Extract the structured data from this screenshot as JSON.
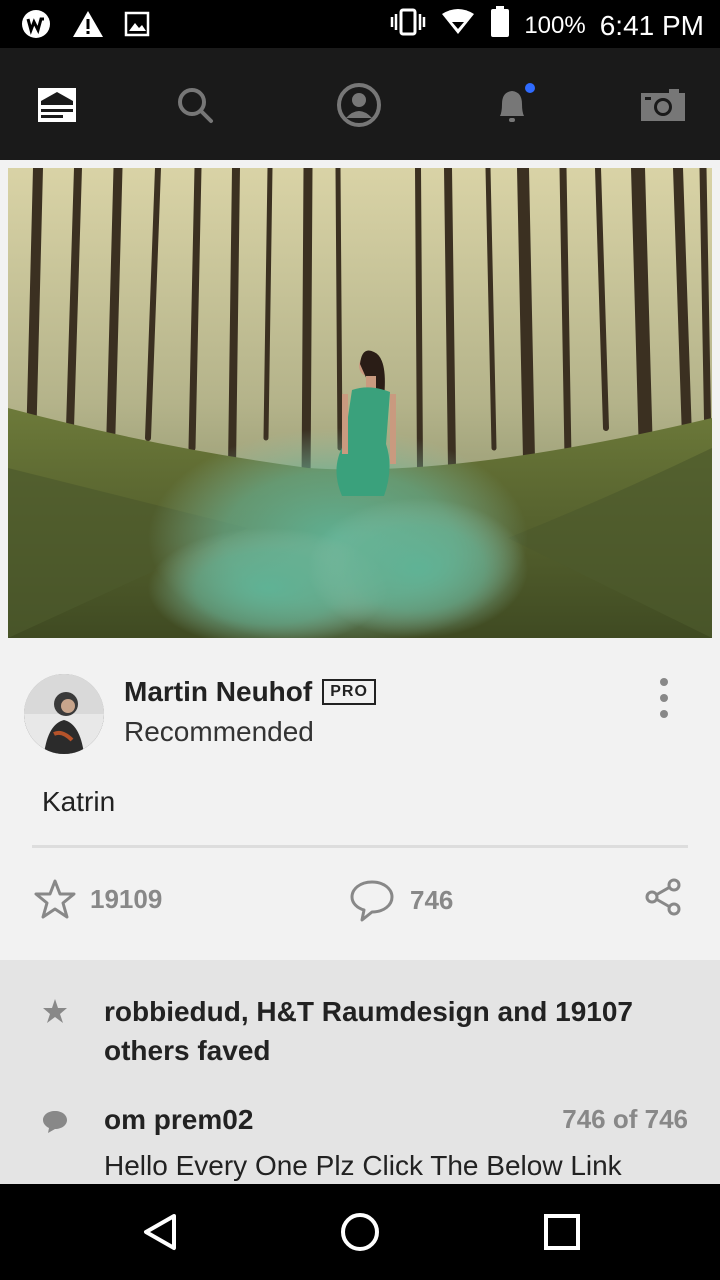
{
  "status_bar": {
    "battery": "100%",
    "time": "6:41 PM",
    "left_icons": [
      "app-logo-icon",
      "warning-icon",
      "image-icon"
    ],
    "right_icons": [
      "vibrate-icon",
      "wifi-icon",
      "battery-icon"
    ]
  },
  "nav": {
    "items": [
      "feed-icon",
      "search-icon",
      "profile-icon",
      "notifications-icon",
      "camera-icon"
    ],
    "notification_dot_color": "#2f6bff"
  },
  "post": {
    "author": "Martin Neuhof",
    "badge": "PRO",
    "subtitle": "Recommended",
    "caption": "Katrin",
    "favs": "19109",
    "comments": "746"
  },
  "activity": {
    "faved_text": "robbiedud, H&T Raumdesign and 19107 others faved",
    "commenter": "om prem02",
    "comment_count": "746 of 746",
    "comment_text": "Hello Every One Plz Click The Below Link"
  },
  "system_nav": [
    "back-icon",
    "home-icon",
    "recents-icon"
  ]
}
